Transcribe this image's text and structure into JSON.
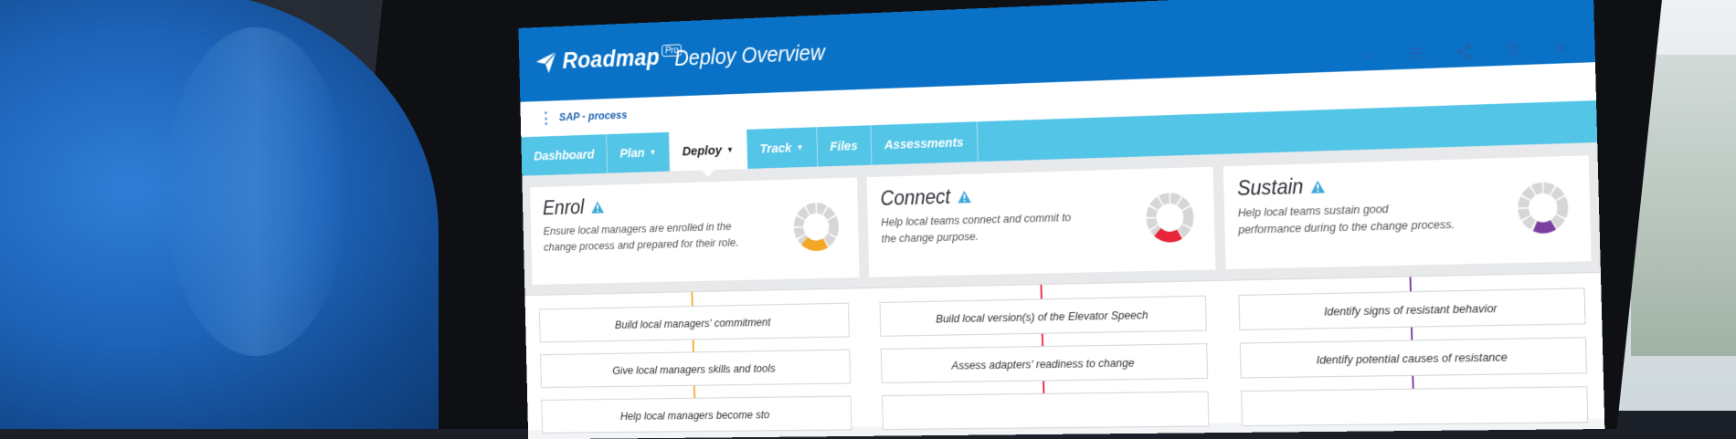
{
  "app": {
    "brand": "Roadmap",
    "brand_badge": "Pro",
    "page_title": "Deploy Overview",
    "process_name": "SAP - process",
    "accent_color": "#0a72c6",
    "tab_bar_color": "#53c5e7"
  },
  "toolbar": {
    "icons": [
      "chevron-down-icon",
      "list-icon",
      "share-icon",
      "history-icon",
      "close-icon"
    ]
  },
  "tabs": [
    {
      "label": "Dashboard",
      "dropdown": false,
      "active": false
    },
    {
      "label": "Plan",
      "dropdown": true,
      "active": false
    },
    {
      "label": "Deploy",
      "dropdown": true,
      "active": true
    },
    {
      "label": "Track",
      "dropdown": true,
      "active": false
    },
    {
      "label": "Files",
      "dropdown": false,
      "active": false
    },
    {
      "label": "Assessments",
      "dropdown": false,
      "active": false
    }
  ],
  "cards": [
    {
      "title": "Enrol",
      "description": "Ensure local managers are enrolled in the change process and prepared for their role.",
      "color": "#f5a623",
      "progress": 0.2
    },
    {
      "title": "Connect",
      "description": "Help local teams connect and commit to the change purpose.",
      "color": "#e8253a",
      "progress": 0.2
    },
    {
      "title": "Sustain",
      "description": "Help local teams sustain good performance during to the change process.",
      "color": "#7b3fa0",
      "progress": 0.15
    }
  ],
  "task_columns": [
    {
      "color": "#f5a623",
      "tasks": [
        "Build local managers' commitment",
        "Give local managers skills and tools",
        "Help local managers become sto"
      ]
    },
    {
      "color": "#e8253a",
      "tasks": [
        "Build local version(s) of the Elevator Speech",
        "Assess adapters' readiness to change",
        ""
      ]
    },
    {
      "color": "#7b3fa0",
      "tasks": [
        "Identify signs of resistant behavior",
        "Identify potential causes of resistance",
        ""
      ]
    }
  ]
}
